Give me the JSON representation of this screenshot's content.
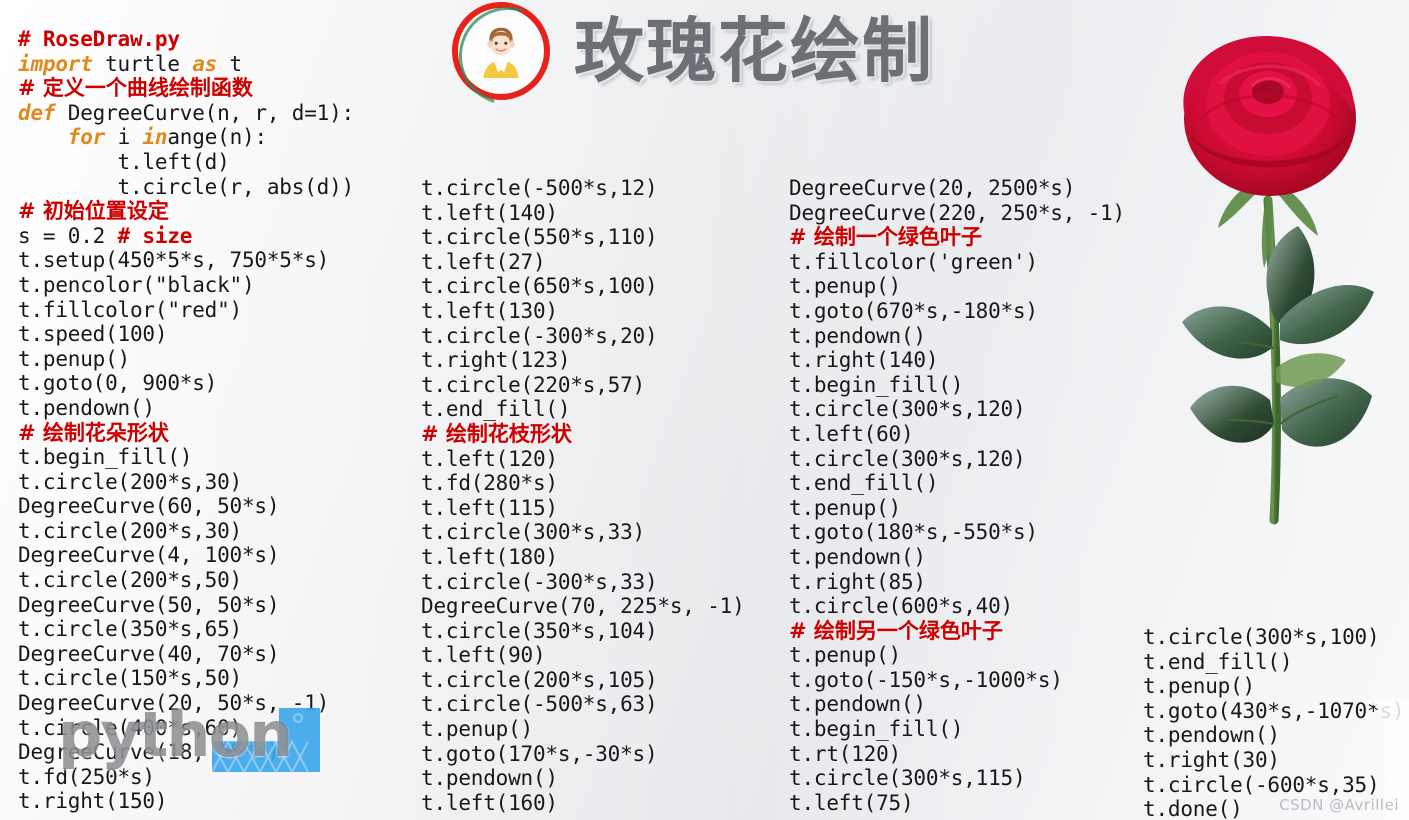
{
  "header": {
    "title": "玫瑰花绘制",
    "avatar_icon": "user-avatar-icon",
    "title_color": "#6b7077",
    "ring_color": "#e8211b"
  },
  "watermarks": {
    "python": "python",
    "csdn": "CSDN @Avrillei"
  },
  "colors": {
    "comment": "#cc0000",
    "keyword": "#e08a1e",
    "code": "#16181a"
  },
  "code": {
    "column1": [
      {
        "t": "# RoseDraw.py",
        "k": "comment"
      },
      {
        "t": "import turtle as t",
        "k": "import"
      },
      {
        "t": "# 定义一个曲线绘制函数",
        "k": "comment-cn"
      },
      {
        "t": "def DegreeCurve(n, r, d=1):",
        "k": "def"
      },
      {
        "t": "    for i in range(n):",
        "k": "for"
      },
      {
        "t": "        t.left(d)",
        "k": "plain"
      },
      {
        "t": "        t.circle(r, abs(d))",
        "k": "plain"
      },
      {
        "t": "# 初始位置设定",
        "k": "comment-cn"
      },
      {
        "t": "s = 0.2 # size",
        "k": "trail-comment"
      },
      {
        "t": "t.setup(450*5*s, 750*5*s)",
        "k": "plain"
      },
      {
        "t": "t.pencolor(\"black\")",
        "k": "plain"
      },
      {
        "t": "t.fillcolor(\"red\")",
        "k": "plain"
      },
      {
        "t": "t.speed(100)",
        "k": "plain"
      },
      {
        "t": "t.penup()",
        "k": "plain"
      },
      {
        "t": "t.goto(0, 900*s)",
        "k": "plain"
      },
      {
        "t": "t.pendown()",
        "k": "plain"
      },
      {
        "t": "# 绘制花朵形状",
        "k": "comment-cn"
      },
      {
        "t": "t.begin_fill()",
        "k": "plain"
      },
      {
        "t": "t.circle(200*s,30)",
        "k": "plain"
      },
      {
        "t": "DegreeCurve(60, 50*s)",
        "k": "plain"
      },
      {
        "t": "t.circle(200*s,30)",
        "k": "plain"
      },
      {
        "t": "DegreeCurve(4, 100*s)",
        "k": "plain"
      },
      {
        "t": "t.circle(200*s,50)",
        "k": "plain"
      },
      {
        "t": "DegreeCurve(50, 50*s)",
        "k": "plain"
      },
      {
        "t": "t.circle(350*s,65)",
        "k": "plain"
      },
      {
        "t": "DegreeCurve(40, 70*s)",
        "k": "plain"
      },
      {
        "t": "t.circle(150*s,50)",
        "k": "plain"
      },
      {
        "t": "DegreeCurve(20, 50*s, -1)",
        "k": "plain"
      },
      {
        "t": "t.circle(400*s,60)",
        "k": "plain"
      },
      {
        "t": "DegreeCurve(18, 50*s)",
        "k": "plain"
      },
      {
        "t": "t.fd(250*s)",
        "k": "plain"
      },
      {
        "t": "t.right(150)",
        "k": "plain"
      }
    ],
    "column2": [
      {
        "t": "t.circle(-500*s,12)",
        "k": "plain"
      },
      {
        "t": "t.left(140)",
        "k": "plain"
      },
      {
        "t": "t.circle(550*s,110)",
        "k": "plain"
      },
      {
        "t": "t.left(27)",
        "k": "plain"
      },
      {
        "t": "t.circle(650*s,100)",
        "k": "plain"
      },
      {
        "t": "t.left(130)",
        "k": "plain"
      },
      {
        "t": "t.circle(-300*s,20)",
        "k": "plain"
      },
      {
        "t": "t.right(123)",
        "k": "plain"
      },
      {
        "t": "t.circle(220*s,57)",
        "k": "plain"
      },
      {
        "t": "t.end_fill()",
        "k": "plain"
      },
      {
        "t": "# 绘制花枝形状",
        "k": "comment-cn"
      },
      {
        "t": "t.left(120)",
        "k": "plain"
      },
      {
        "t": "t.fd(280*s)",
        "k": "plain"
      },
      {
        "t": "t.left(115)",
        "k": "plain"
      },
      {
        "t": "t.circle(300*s,33)",
        "k": "plain"
      },
      {
        "t": "t.left(180)",
        "k": "plain"
      },
      {
        "t": "t.circle(-300*s,33)",
        "k": "plain"
      },
      {
        "t": "DegreeCurve(70, 225*s, -1)",
        "k": "plain"
      },
      {
        "t": "t.circle(350*s,104)",
        "k": "plain"
      },
      {
        "t": "t.left(90)",
        "k": "plain"
      },
      {
        "t": "t.circle(200*s,105)",
        "k": "plain"
      },
      {
        "t": "t.circle(-500*s,63)",
        "k": "plain"
      },
      {
        "t": "t.penup()",
        "k": "plain"
      },
      {
        "t": "t.goto(170*s,-30*s)",
        "k": "plain"
      },
      {
        "t": "t.pendown()",
        "k": "plain"
      },
      {
        "t": "t.left(160)",
        "k": "plain"
      }
    ],
    "column3": [
      {
        "t": "DegreeCurve(20, 2500*s)",
        "k": "plain"
      },
      {
        "t": "DegreeCurve(220, 250*s, -1)",
        "k": "plain"
      },
      {
        "t": "# 绘制一个绿色叶子",
        "k": "comment-cn"
      },
      {
        "t": "t.fillcolor('green')",
        "k": "plain"
      },
      {
        "t": "t.penup()",
        "k": "plain"
      },
      {
        "t": "t.goto(670*s,-180*s)",
        "k": "plain"
      },
      {
        "t": "t.pendown()",
        "k": "plain"
      },
      {
        "t": "t.right(140)",
        "k": "plain"
      },
      {
        "t": "t.begin_fill()",
        "k": "plain"
      },
      {
        "t": "t.circle(300*s,120)",
        "k": "plain"
      },
      {
        "t": "t.left(60)",
        "k": "plain"
      },
      {
        "t": "t.circle(300*s,120)",
        "k": "plain"
      },
      {
        "t": "t.end_fill()",
        "k": "plain"
      },
      {
        "t": "t.penup()",
        "k": "plain"
      },
      {
        "t": "t.goto(180*s,-550*s)",
        "k": "plain"
      },
      {
        "t": "t.pendown()",
        "k": "plain"
      },
      {
        "t": "t.right(85)",
        "k": "plain"
      },
      {
        "t": "t.circle(600*s,40)",
        "k": "plain"
      },
      {
        "t": "# 绘制另一个绿色叶子",
        "k": "comment-cn"
      },
      {
        "t": "t.penup()",
        "k": "plain"
      },
      {
        "t": "t.goto(-150*s,-1000*s)",
        "k": "plain"
      },
      {
        "t": "t.pendown()",
        "k": "plain"
      },
      {
        "t": "t.begin_fill()",
        "k": "plain"
      },
      {
        "t": "t.rt(120)",
        "k": "plain"
      },
      {
        "t": "t.circle(300*s,115)",
        "k": "plain"
      },
      {
        "t": "t.left(75)",
        "k": "plain"
      }
    ],
    "column4": [
      {
        "t": "t.circle(300*s,100)",
        "k": "plain"
      },
      {
        "t": "t.end_fill()",
        "k": "plain"
      },
      {
        "t": "t.penup()",
        "k": "plain"
      },
      {
        "t": "t.goto(430*s,-1070*s)",
        "k": "plain"
      },
      {
        "t": "t.pendown()",
        "k": "plain"
      },
      {
        "t": "t.right(30)",
        "k": "plain"
      },
      {
        "t": "t.circle(-600*s,35)",
        "k": "plain"
      },
      {
        "t": "t.done()",
        "k": "plain"
      }
    ]
  }
}
